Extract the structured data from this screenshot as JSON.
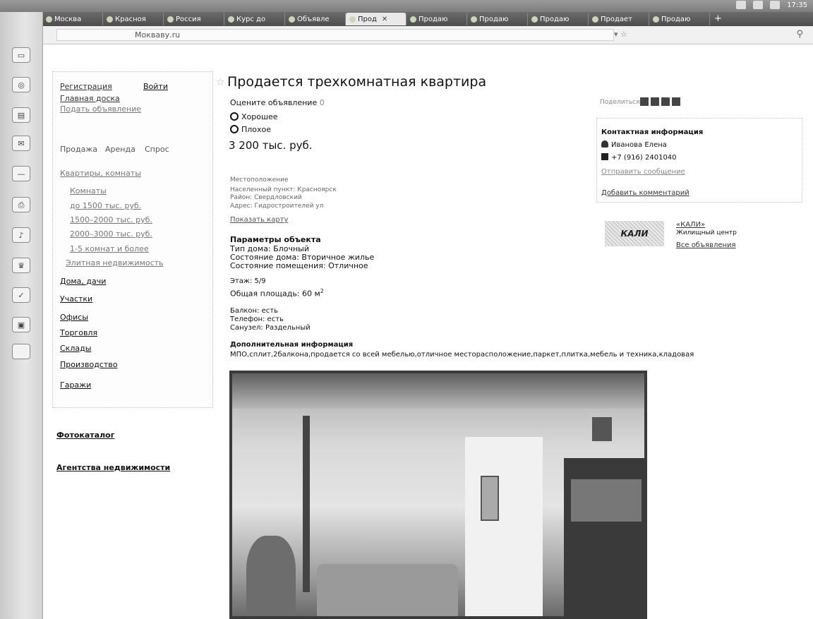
{
  "browser": {
    "tabs": [
      {
        "label": "Москва"
      },
      {
        "label": "Красноя"
      },
      {
        "label": "Россия"
      },
      {
        "label": "Курс до"
      },
      {
        "label": "Объявле"
      },
      {
        "label": "Прод"
      },
      {
        "label": "Продаю"
      },
      {
        "label": "Продаю"
      },
      {
        "label": "Продаю"
      },
      {
        "label": "Продает"
      },
      {
        "label": "Продаю"
      }
    ],
    "address_value": "Мокваву.ru",
    "tray_time": "17:35"
  },
  "sidebar": {
    "register_link": "Регистрация",
    "login_button": "Войти",
    "board_link": "Главная доска",
    "post_ad_link": "Подать объявление",
    "deal_tabs": [
      "Продажа",
      "Аренда",
      "Спрос"
    ],
    "category_flats": "Квартиры, комнаты",
    "subcategories": [
      "Комнаты",
      "до 1500 тыс. руб.",
      "1500–2000 тыс. руб.",
      "2000–3000 тыс. руб.",
      "1-5 комнат и более",
      "Элитная недвижимость"
    ],
    "categories": [
      "Дома, дачи",
      "Участки",
      "Офисы",
      "Торговля",
      "Склады",
      "Производство",
      "Гаражи"
    ],
    "photo_catalog": "Фотокаталог",
    "agencies": "Агентства недвижимости"
  },
  "listing": {
    "title": "Продается трехкомнатная квартира",
    "rate_prompt": "Оцените объявление",
    "rate_count": "0",
    "vote_good": "Хорошее",
    "vote_bad": "Плохое",
    "price": "3 200 тыс. руб.",
    "price_note": "",
    "location_heading": "Местоположение",
    "location_lines": [
      "Населенный пункт: Красноярск",
      "Район: Свердловский",
      "Адрес: Гидростроителей ул"
    ],
    "map_link": "Показать карту",
    "params_heading": "Параметры объекта",
    "params": [
      "Тип дома: Блочный",
      "Состояние дома: Вторичное жилье",
      "Состояние помещения: Отличное"
    ],
    "floor": "Этаж: 5/9",
    "area_label": "Общая площадь: 60 м",
    "area_unit_sup": "2",
    "extras": [
      "Балкон: есть",
      "Телефон: есть",
      "Санузел: Раздельный"
    ],
    "extra_heading": "Дополнительная информация",
    "extra_text": "МПО,сплит,2балкона,продается со всей мебелью,отличное месторасположение,паркет,плитка,мебель и техника,кладовая",
    "photo_caption": ""
  },
  "contact": {
    "share_label": "Поделиться",
    "heading": "Контактная информация",
    "name": "Иванова Елена",
    "phone": "+7 (916) 2401040",
    "message_link": "Отправить сообщение",
    "comment_link": "Добавить комментарий",
    "agency_name": "«КАЛИ»",
    "agency_type": "Жилищный центр",
    "agency_all_ads": "Все объявления",
    "agency_logo_text": "КАЛИ"
  }
}
